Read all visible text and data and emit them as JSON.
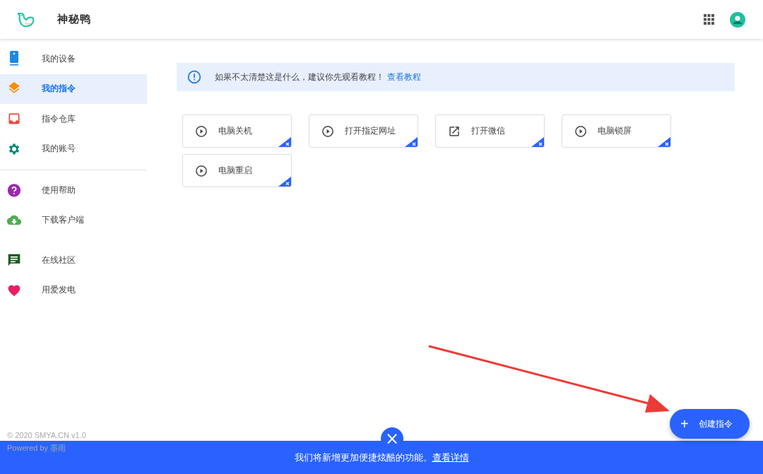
{
  "header": {
    "title": "神秘鸭"
  },
  "sidebar": {
    "sections": [
      {
        "items": [
          {
            "label": "我的设备",
            "selected": false
          },
          {
            "label": "我的指令",
            "selected": true
          },
          {
            "label": "指令仓库",
            "selected": false
          },
          {
            "label": "我的账号",
            "selected": false
          }
        ]
      },
      {
        "items": [
          {
            "label": "使用帮助",
            "selected": false
          },
          {
            "label": "下载客户端",
            "selected": false
          }
        ]
      },
      {
        "items": [
          {
            "label": "在线社区",
            "selected": false
          },
          {
            "label": "用爱发电",
            "selected": false
          }
        ]
      }
    ],
    "footer": {
      "copyright": "© 2020 SMYA.CN v1.0",
      "powered": "Powered by",
      "powered_link": "墨雨"
    }
  },
  "notice": {
    "text": "如果不太清楚这是什么，建议你先观看教程！",
    "link": "查看教程"
  },
  "commands": [
    {
      "label": "电脑关机",
      "kind": "run"
    },
    {
      "label": "打开指定网址",
      "kind": "run"
    },
    {
      "label": "打开微信",
      "kind": "open"
    },
    {
      "label": "电脑锁屏",
      "kind": "run"
    },
    {
      "label": "电脑重启",
      "kind": "run"
    }
  ],
  "fab": {
    "icon_text": "+",
    "label": "创建指令"
  },
  "banner": {
    "close": "×",
    "text": "我们将新增更加便捷炫酷的功能。",
    "link": "查看详情"
  }
}
